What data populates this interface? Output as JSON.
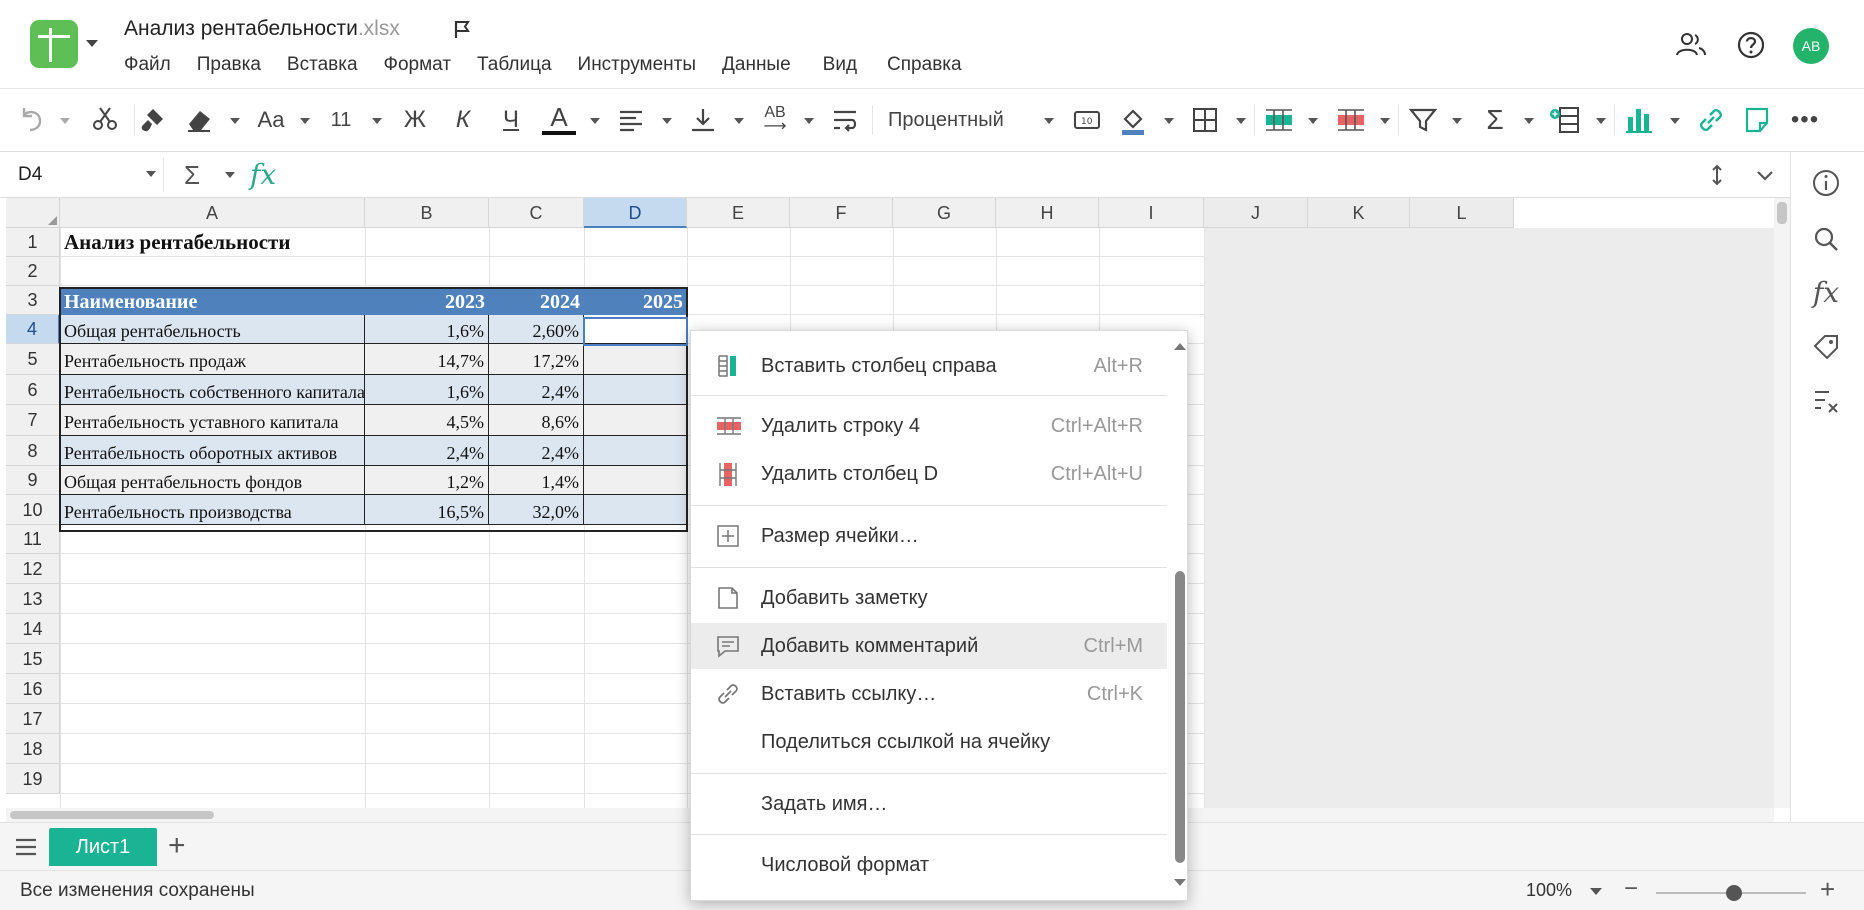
{
  "app": {
    "doc_name": "Анализ рентабельности",
    "doc_ext": ".xlsx",
    "user_initials": "АВ",
    "brand_color": "#1ab394"
  },
  "menu": [
    "Файл",
    "Правка",
    "Вставка",
    "Формат",
    "Таблица",
    "Инструменты",
    "Данные",
    "Вид",
    "Справка"
  ],
  "toolbar": {
    "font_name": "Aa",
    "font_size": "11",
    "bold": "Ж",
    "italic": "К",
    "underline": "Ч",
    "font_color": "A",
    "wrap": "AB",
    "number_format": "Процентный"
  },
  "formula_bar": {
    "cell_ref": "D4",
    "sum": "Σ",
    "fx": "fx",
    "value": ""
  },
  "grid": {
    "columns": [
      "A",
      "B",
      "C",
      "D",
      "E",
      "F",
      "G",
      "H",
      "I",
      "J",
      "K",
      "L"
    ],
    "selected_column": "D",
    "rows": [
      "1",
      "2",
      "3",
      "4",
      "5",
      "6",
      "7",
      "8",
      "9",
      "10",
      "11",
      "12",
      "13",
      "14",
      "15",
      "16",
      "17",
      "18",
      "19"
    ],
    "selected_row": "4",
    "title": "Анализ рентабельности",
    "table_header": [
      "Наименование",
      "2023",
      "2024",
      "2025"
    ],
    "table_rows": [
      [
        "Общая рентабельность",
        "1,6%",
        "2,60%",
        ""
      ],
      [
        "Рентабельность продаж",
        "14,7%",
        "17,2%",
        ""
      ],
      [
        "Рентабельность собственного капитала",
        "1,6%",
        "2,4%",
        ""
      ],
      [
        "Рентабельность уставного капитала",
        "4,5%",
        "8,6%",
        ""
      ],
      [
        "Рентабельность оборотных активов",
        "2,4%",
        "2,4%",
        ""
      ],
      [
        "Общая рентабельность фондов",
        "1,2%",
        "1,4%",
        ""
      ],
      [
        "Рентабельность производства",
        "16,5%",
        "32,0%",
        ""
      ]
    ]
  },
  "context_menu": [
    {
      "label": "Вставить столбец справа",
      "shortcut": "Alt+R",
      "icon": "insert-column-right-icon"
    },
    {
      "label": "Удалить строку 4",
      "shortcut": "Ctrl+Alt+R",
      "icon": "delete-row-icon"
    },
    {
      "label": "Удалить столбец D",
      "shortcut": "Ctrl+Alt+U",
      "icon": "delete-column-icon"
    },
    {
      "label": "Размер ячейки…",
      "shortcut": "",
      "icon": "cell-size-icon"
    },
    {
      "label": "Добавить заметку",
      "shortcut": "",
      "icon": "note-icon"
    },
    {
      "label": "Добавить комментарий",
      "shortcut": "Ctrl+M",
      "icon": "comment-icon"
    },
    {
      "label": "Вставить ссылку…",
      "shortcut": "Ctrl+K",
      "icon": "link-icon"
    },
    {
      "label": "Поделиться ссылкой на ячейку",
      "shortcut": "",
      "icon": ""
    },
    {
      "label": "Задать имя…",
      "shortcut": "",
      "icon": ""
    },
    {
      "label": "Числовой формат",
      "shortcut": "",
      "icon": ""
    }
  ],
  "sheets": {
    "active": "Лист1"
  },
  "status": {
    "text": "Все изменения сохранены",
    "zoom": "100%"
  }
}
